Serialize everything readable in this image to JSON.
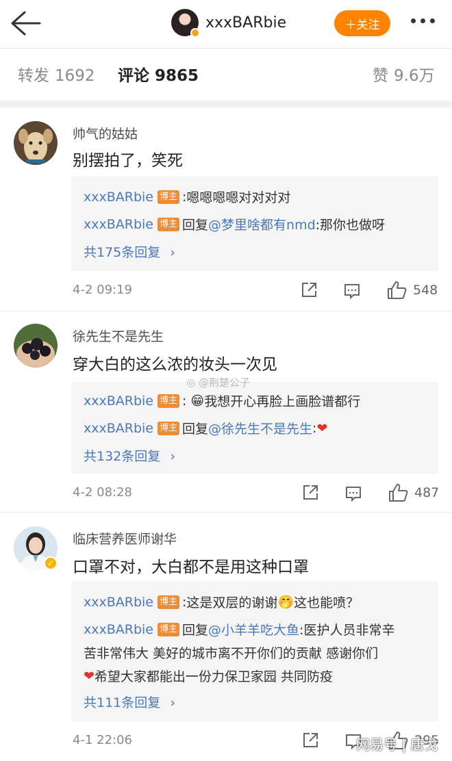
{
  "header": {
    "username": "xxxBARbie",
    "follow_label": "＋关注"
  },
  "tabs": {
    "repost_label": "转发",
    "repost_count": "1692",
    "comment_label": "评论",
    "comment_count": "9865",
    "like_label": "赞",
    "like_count": "9.6万"
  },
  "comments": [
    {
      "name": "帅气的姑姑",
      "text": "别摆拍了，笑死",
      "replies": [
        {
          "user": "xxxBARbie",
          "tag": "博主",
          "prefix": ":",
          "text": " 嗯嗯嗯嗯对对对对"
        },
        {
          "user": "xxxBARbie",
          "tag": "博主",
          "prefix": "回复",
          "at": "@梦里啥都有nmd",
          "text": ":那你也做呀"
        }
      ],
      "more": "共175条回复",
      "time": "4-2 09:19",
      "likes": "548"
    },
    {
      "name": "徐先生不是先生",
      "text": "穿大白的这么浓的妆头一次见",
      "replies": [
        {
          "user": "xxxBARbie",
          "tag": "博主",
          "prefix": ":",
          "emoji": "😁",
          "text": "我想开心再脸上画脸谱都行"
        },
        {
          "user": "xxxBARbie",
          "tag": "博主",
          "prefix": "回复",
          "at": "@徐先生不是先生",
          "text": ":",
          "heart": "❤"
        }
      ],
      "more": "共132条回复",
      "time": "4-2 08:28",
      "likes": "487"
    },
    {
      "name": "临床营养医师谢华",
      "text": "口罩不对，大白都不是用这种口罩",
      "replies": [
        {
          "user": "xxxBARbie",
          "tag": "博主",
          "prefix": ":",
          "text": " 这是双层的谢谢",
          "emoji": "🤭",
          "text2": "这也能喷？"
        },
        {
          "user": "xxxBARbie",
          "tag": "博主",
          "prefix": "回复",
          "at": "@小羊羊吃大鱼",
          "text": ":医护人员非常辛"
        }
      ],
      "reply_cont": [
        "苦非常伟大 美好的城市离不开你们的贡献 感谢你们",
        "希望大家都能出一份力保卫家园 共同防疫"
      ],
      "heart": "❤",
      "more": "共111条回复",
      "time": "4-1 22:06",
      "likes": "295"
    }
  ],
  "watermarks": {
    "mid": "@荆楚公子",
    "corner": "网易号 | 唐戈"
  },
  "icons": [
    "back-arrow-icon",
    "share-icon",
    "comment-icon",
    "thumbs-up-icon",
    "more-dots-icon"
  ]
}
